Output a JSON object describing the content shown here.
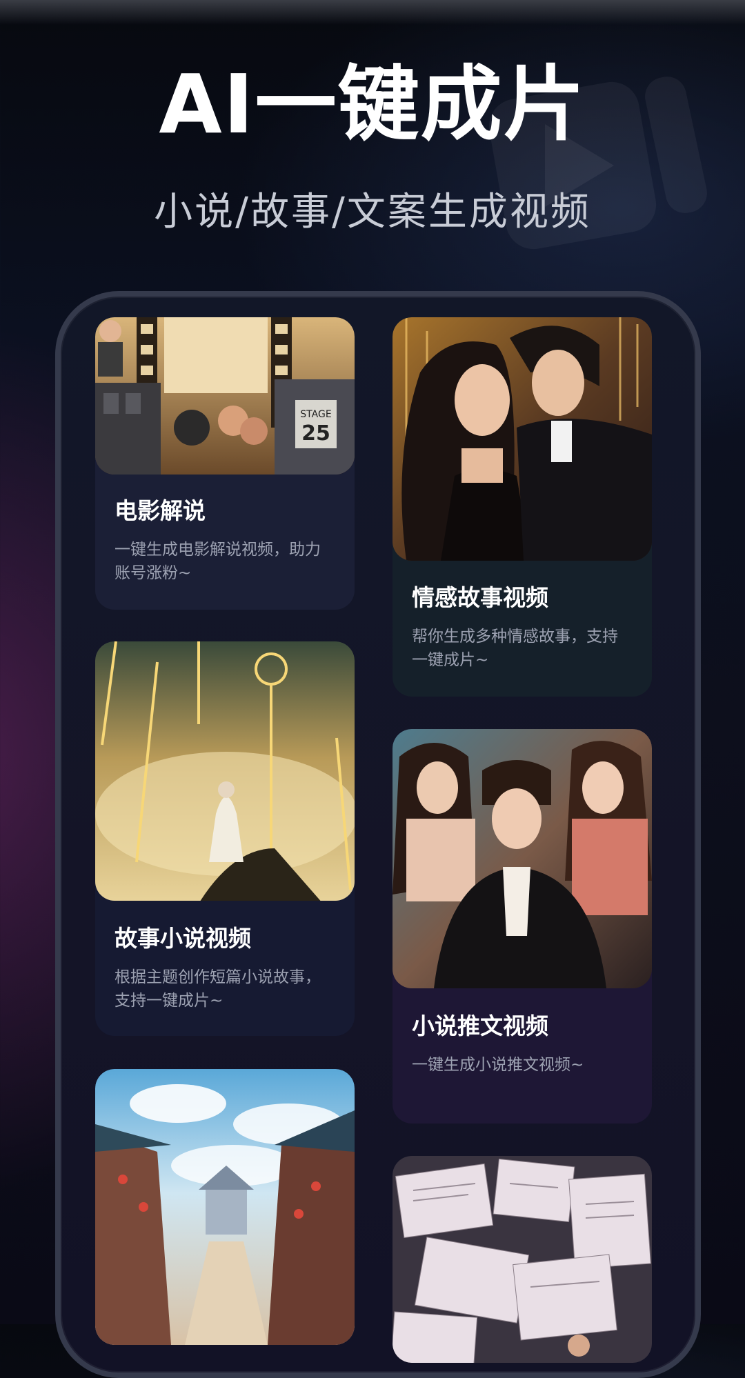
{
  "header": {
    "title": "AI一键成片",
    "subtitle": "小说/故事/文案生成视频"
  },
  "icons": {
    "decoration": "play-logo-icon"
  },
  "cards": [
    {
      "title": "电影解说",
      "desc": "一键生成电影解说视频，助力账号涨粉~",
      "image": "film-collage-image"
    },
    {
      "title": "情感故事视频",
      "desc": "帮你生成多种情感故事，支持一键成片~",
      "image": "couple-illustration-image"
    },
    {
      "title": "故事小说视频",
      "desc": "根据主题创作短篇小说故事，支持一键成片~",
      "image": "fantasy-swords-image"
    },
    {
      "title": "小说推文视频",
      "desc": "一键生成小说推文视频~",
      "image": "trio-portrait-image"
    },
    {
      "title": "",
      "desc": "",
      "image": "ancient-street-image"
    },
    {
      "title": "",
      "desc": "",
      "image": "papers-collage-image"
    }
  ],
  "colors": {
    "background": "#0b1020",
    "phone_frame": "#353a4c",
    "card_1": "#1b1f36",
    "card_2": "#15202a",
    "card_3": "#161a32",
    "card_4": "#1e1735",
    "title_text": "#ffffff",
    "desc_text": "#9da2b2"
  }
}
